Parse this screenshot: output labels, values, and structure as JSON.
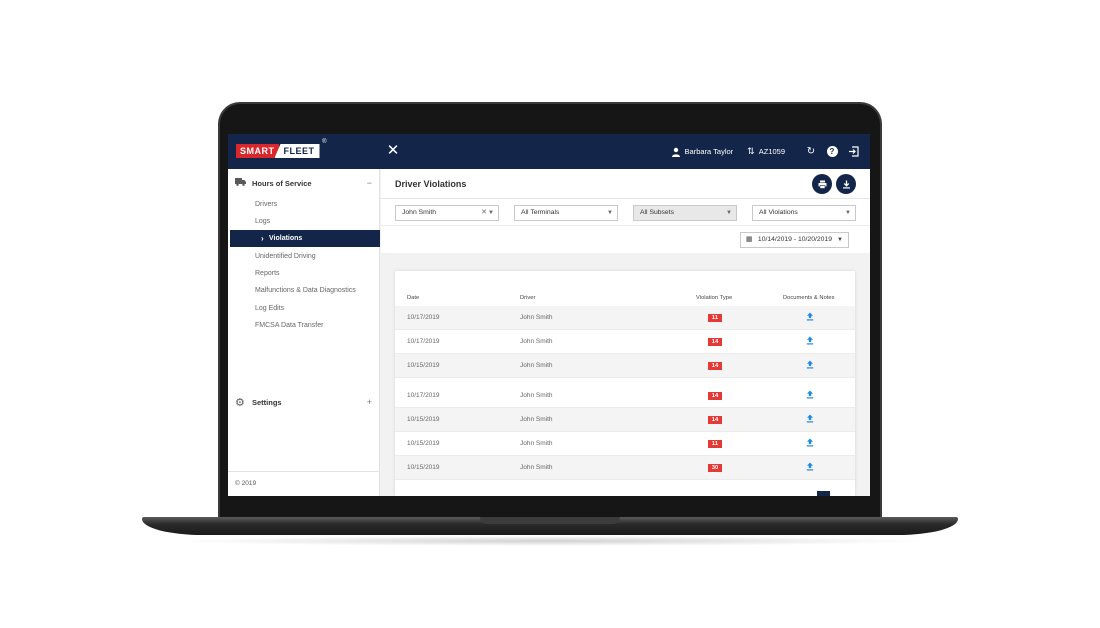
{
  "brand": {
    "smart": "SMART",
    "fleet": "FLEET",
    "registered": "®"
  },
  "header": {
    "close_icon": "close-icon",
    "user_name": "Barbara Taylor",
    "unit": "AZ1059",
    "icons": [
      "user-icon",
      "swap-icon",
      "refresh-icon",
      "help-icon",
      "logout-icon"
    ]
  },
  "sidebar": {
    "hos_section": {
      "label": "Hours of Service",
      "toggle": "−",
      "icon": "truck-icon"
    },
    "items": [
      {
        "label": "Drivers"
      },
      {
        "label": "Logs"
      },
      {
        "label": "Violations",
        "active": true
      },
      {
        "label": "Unidentified Driving"
      },
      {
        "label": "Reports"
      },
      {
        "label": "Malfunctions & Data Diagnostics"
      },
      {
        "label": "Log Edits"
      },
      {
        "label": "FMCSA Data Transfer"
      }
    ],
    "settings_section": {
      "label": "Settings",
      "toggle": "+",
      "icon": "gear-icon"
    },
    "copyright": "© 2019"
  },
  "main": {
    "title": "Driver Violations",
    "actions": [
      "print-icon",
      "download-icon"
    ],
    "filters": {
      "driver": "John Smith",
      "terminals": "All Terminals",
      "subsets": "All Subsets",
      "violations": "All Violations"
    },
    "date_range": "10/14/2019 - 10/20/2019",
    "table": {
      "columns": [
        "Date",
        "Driver",
        "Violation Type",
        "Documents & Notes"
      ],
      "rows": [
        {
          "date": "10/17/2019",
          "driver": "John Smith",
          "type": "11"
        },
        {
          "date": "10/17/2019",
          "driver": "John Smith",
          "type": "14"
        },
        {
          "date": "10/15/2019",
          "driver": "John Smith",
          "type": "14"
        },
        {
          "date": "10/17/2019",
          "driver": "John Smith",
          "type": "14"
        },
        {
          "date": "10/15/2019",
          "driver": "John Smith",
          "type": "14"
        },
        {
          "date": "10/15/2019",
          "driver": "John Smith",
          "type": "11"
        },
        {
          "date": "10/15/2019",
          "driver": "John Smith",
          "type": "30"
        }
      ]
    }
  },
  "colors": {
    "navy": "#13264a",
    "brand_red": "#d8272d",
    "badge_red": "#e53935",
    "link_blue": "#1e88e5"
  }
}
